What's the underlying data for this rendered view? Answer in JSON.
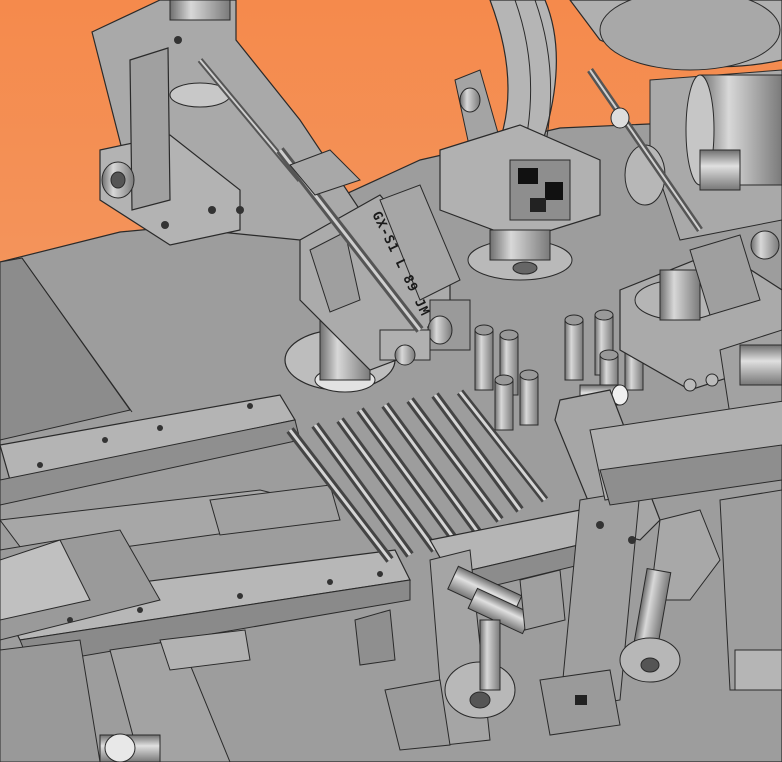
{
  "viewport": {
    "background_top": "#f58a4c",
    "background_bottom": "#f2a677"
  },
  "colors": {
    "metal_light": "#b9b9b9",
    "metal_mid": "#9c9c9c",
    "metal_dark": "#7a7a7a",
    "edge": "#2a2a2a",
    "bright": "#e6e6e6"
  },
  "part_marking": {
    "text": "GX-S1 L 89 JM 71E"
  }
}
